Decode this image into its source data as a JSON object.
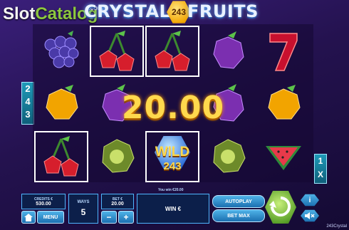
{
  "header": {
    "title_left": "CRYSTAL",
    "badge": "243",
    "title_right": "FRUITS",
    "watermark_slot": "Slot",
    "watermark_catalog": "Catalog",
    "watermark_com": ".com"
  },
  "reels": {
    "left_ways": [
      "2",
      "4",
      "3"
    ],
    "right_multiplier": [
      "1",
      "X"
    ],
    "win_amount": "20.00",
    "wild_word": "WILD",
    "wild_number": "243",
    "grid": [
      [
        "grapes-icon",
        "cherries-icon",
        "cherries-icon",
        "plum-icon",
        "seven-icon"
      ],
      [
        "orange-icon",
        "watermelon-icon",
        "lime-icon",
        "watermelon-icon",
        "orange-icon"
      ],
      [
        "cherries-icon",
        "kiwi-icon",
        "wild-icon",
        "kiwi-icon",
        "watermelon-icon"
      ]
    ]
  },
  "panel": {
    "you_win_text": "You win €20.00",
    "credits_label": "CREDITS €",
    "credits_value": "530.00",
    "ways_label": "WAYS",
    "ways_value": "5",
    "bet_label": "BET €",
    "bet_value": "20.00",
    "win_label": "WIN €",
    "menu_label": "MENU",
    "autoplay_label": "AUTOPLAY",
    "betmax_label": "BET MAX",
    "info_label": "i"
  },
  "footer": {
    "version": "243Crystal"
  },
  "colors": {
    "background": "#24124f",
    "accent_blue": "#4fb6ff",
    "win_gold": "#ffd94d",
    "spin_green": "#8fd14f"
  }
}
